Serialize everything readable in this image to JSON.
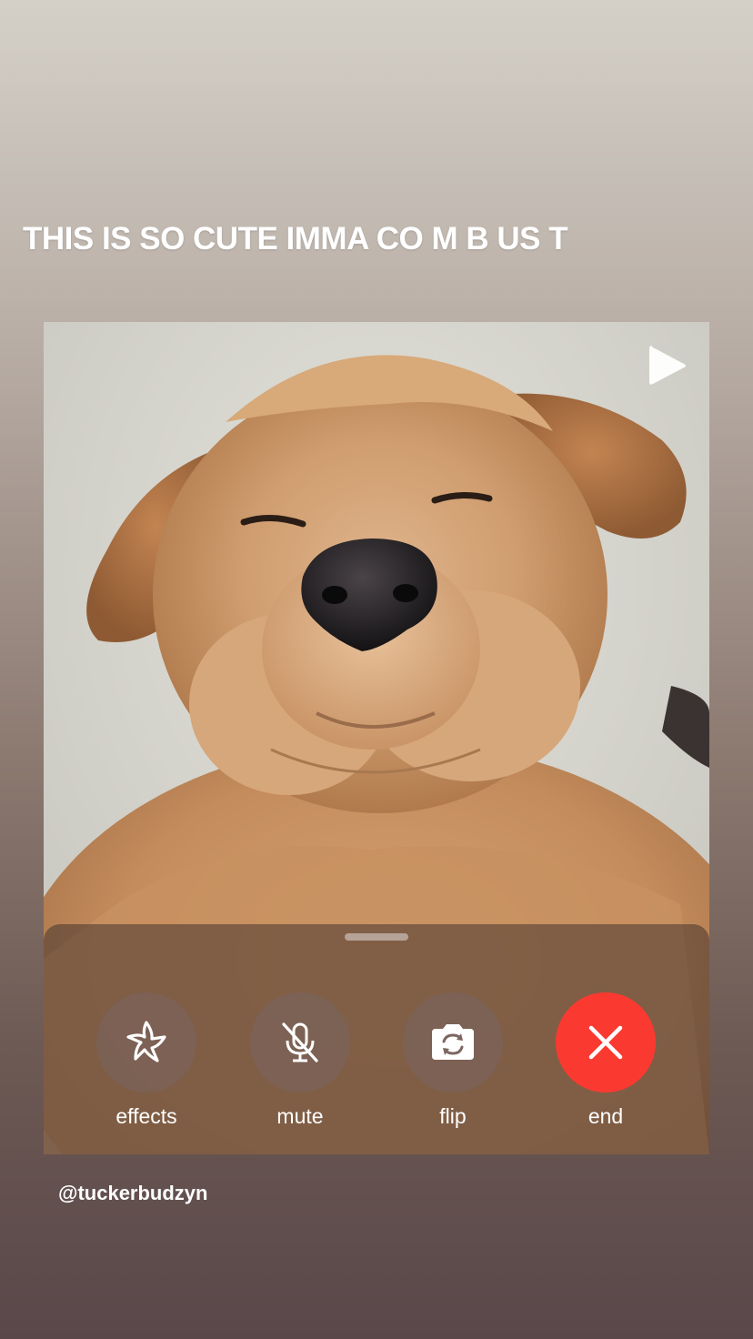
{
  "story": {
    "caption": "THIS IS SO CUTE IMMA CO M B US T",
    "credit": "@tuckerbudzyn"
  },
  "video": {
    "subject_icon": "golden-retriever-photo",
    "play_icon": "play-icon"
  },
  "call_controls": {
    "effects": {
      "label": "effects",
      "icon": "star-effects-icon"
    },
    "mute": {
      "label": "mute",
      "icon": "mic-slash-icon"
    },
    "flip": {
      "label": "flip",
      "icon": "camera-flip-icon"
    },
    "end": {
      "label": "end",
      "icon": "close-icon",
      "color": "#fa3a31"
    }
  }
}
